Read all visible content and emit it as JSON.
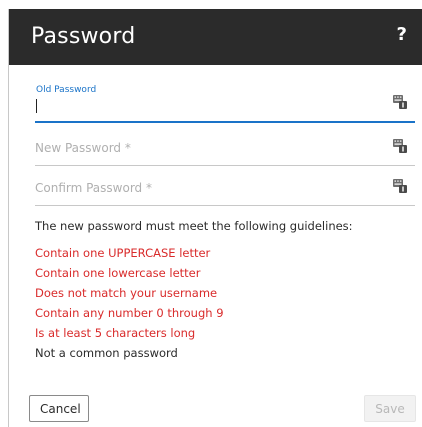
{
  "dialog": {
    "title": "Password",
    "help_label": "?"
  },
  "fields": {
    "old_password": {
      "label": "Old Password",
      "value": "",
      "placeholder": ""
    },
    "new_password": {
      "value": "",
      "placeholder": "New Password *"
    },
    "confirm_password": {
      "value": "",
      "placeholder": "Confirm Password *"
    }
  },
  "guidelines_heading": "The new password must meet the following guidelines:",
  "rules": [
    {
      "text": "Contain one UPPERCASE letter",
      "met": false
    },
    {
      "text": "Contain one lowercase letter",
      "met": false
    },
    {
      "text": "Does not match your username",
      "met": false
    },
    {
      "text": "Contain any number 0 through 9",
      "met": false
    },
    {
      "text": "Is at least 5 characters long",
      "met": false
    },
    {
      "text": "Not a common password",
      "met": true
    }
  ],
  "buttons": {
    "cancel": "Cancel",
    "save": "Save"
  },
  "colors": {
    "header_bg": "#2b2b2b",
    "accent": "#1a73c8",
    "rule_unmet": "#d92b2b",
    "rule_met": "#2b2b2b",
    "disabled_text": "#b8b8b8"
  },
  "icons": {
    "field_action": "password-keyboard-icon"
  }
}
